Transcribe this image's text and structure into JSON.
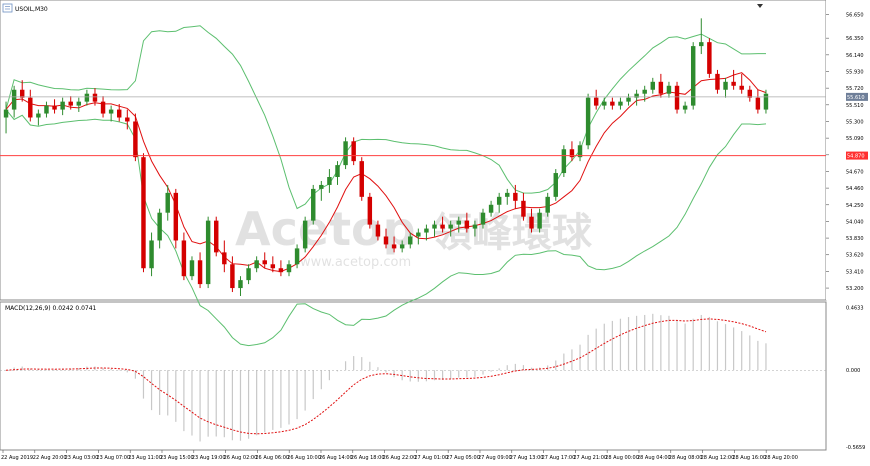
{
  "window": {
    "title": "USOIL,M30",
    "macd_label": "MACD(12,26,9) 0.0242 0.0741"
  },
  "watermark": {
    "brand": "Acetop",
    "cn": "領峰環球",
    "url": "www.acetop.com"
  },
  "colors": {
    "bull": "#2e8b2e",
    "bear": "#d40000",
    "bollinger": "#5cbf6f",
    "ma": "#e01010",
    "hline": "#ff4040",
    "macd_hist": "#c8c8c8",
    "macd_signal": "#e01010"
  },
  "chart_data": [
    {
      "type": "candlestick",
      "symbol": "USOIL",
      "timeframe": "M30",
      "ylim": [
        53.1,
        56.68
      ],
      "y_ticks": [
        "56.650",
        "56.350",
        "56.140",
        "55.930",
        "55.720",
        "55.510",
        "55.300",
        "55.090",
        "54.880",
        "54.670",
        "54.460",
        "54.250",
        "54.040",
        "53.830",
        "53.620",
        "53.410",
        "53.200"
      ],
      "current_price": 55.61,
      "current_price_label": "55.610",
      "level": 54.87,
      "level_label": "54.870",
      "x_labels": [
        "22 Aug 2019",
        "22 Aug 20:00",
        "23 Aug 03:00",
        "23 Aug 07:00",
        "23 Aug 11:00",
        "23 Aug 15:00",
        "23 Aug 19:00",
        "26 Aug 02:00",
        "26 Aug 06:00",
        "26 Aug 10:00",
        "26 Aug 14:00",
        "26 Aug 18:00",
        "26 Aug 22:00",
        "27 Aug 01:00",
        "27 Aug 05:00",
        "27 Aug 09:00",
        "27 Aug 13:00",
        "27 Aug 17:00",
        "27 Aug 21:00",
        "28 Aug 00:00",
        "28 Aug 04:00",
        "28 Aug 08:00",
        "28 Aug 12:00",
        "28 Aug 16:00",
        "28 Aug 20:00"
      ],
      "candles": [
        [
          55.35,
          55.55,
          55.15,
          55.45
        ],
        [
          55.45,
          55.75,
          55.35,
          55.7
        ],
        [
          55.7,
          55.82,
          55.55,
          55.6
        ],
        [
          55.6,
          55.7,
          55.3,
          55.35
        ],
        [
          55.35,
          55.45,
          55.25,
          55.4
        ],
        [
          55.4,
          55.55,
          55.35,
          55.5
        ],
        [
          55.5,
          55.58,
          55.4,
          55.45
        ],
        [
          55.45,
          55.6,
          55.38,
          55.55
        ],
        [
          55.55,
          55.62,
          55.45,
          55.5
        ],
        [
          55.5,
          55.6,
          55.42,
          55.55
        ],
        [
          55.55,
          55.7,
          55.5,
          55.65
        ],
        [
          55.65,
          55.72,
          55.5,
          55.55
        ],
        [
          55.55,
          55.62,
          55.35,
          55.4
        ],
        [
          55.4,
          55.5,
          55.3,
          55.45
        ],
        [
          55.45,
          55.52,
          55.3,
          55.35
        ],
        [
          55.35,
          55.45,
          55.2,
          55.3
        ],
        [
          55.3,
          55.4,
          54.8,
          54.85
        ],
        [
          54.85,
          54.9,
          53.4,
          53.45
        ],
        [
          53.45,
          53.9,
          53.35,
          53.8
        ],
        [
          53.8,
          54.2,
          53.7,
          54.15
        ],
        [
          54.15,
          54.5,
          54.05,
          54.4
        ],
        [
          54.4,
          54.45,
          53.7,
          53.8
        ],
        [
          53.8,
          53.9,
          53.3,
          53.35
        ],
        [
          53.35,
          53.6,
          53.3,
          53.55
        ],
        [
          53.55,
          53.65,
          53.2,
          53.25
        ],
        [
          53.25,
          54.1,
          53.2,
          54.05
        ],
        [
          54.05,
          54.1,
          53.6,
          53.65
        ],
        [
          53.65,
          53.8,
          53.4,
          53.5
        ],
        [
          53.5,
          53.6,
          53.15,
          53.2
        ],
        [
          53.2,
          53.35,
          53.1,
          53.3
        ],
        [
          53.3,
          53.5,
          53.25,
          53.45
        ],
        [
          53.45,
          53.6,
          53.4,
          53.55
        ],
        [
          53.55,
          53.65,
          53.45,
          53.5
        ],
        [
          53.5,
          53.6,
          53.4,
          53.45
        ],
        [
          53.45,
          53.55,
          53.35,
          53.4
        ],
        [
          53.4,
          53.55,
          53.35,
          53.5
        ],
        [
          53.5,
          53.75,
          53.45,
          53.7
        ],
        [
          53.7,
          54.1,
          53.65,
          54.05
        ],
        [
          54.05,
          54.5,
          54.0,
          54.45
        ],
        [
          54.45,
          54.55,
          54.3,
          54.5
        ],
        [
          54.5,
          54.7,
          54.4,
          54.6
        ],
        [
          54.6,
          54.8,
          54.5,
          54.75
        ],
        [
          54.75,
          55.1,
          54.7,
          55.05
        ],
        [
          55.05,
          55.1,
          54.75,
          54.8
        ],
        [
          54.8,
          54.85,
          54.3,
          54.35
        ],
        [
          54.35,
          54.4,
          53.95,
          54.0
        ],
        [
          54.0,
          54.05,
          53.8,
          53.85
        ],
        [
          53.85,
          53.95,
          53.7,
          53.75
        ],
        [
          53.75,
          53.85,
          53.65,
          53.7
        ],
        [
          53.7,
          53.8,
          53.65,
          53.75
        ],
        [
          53.75,
          53.9,
          53.7,
          53.85
        ],
        [
          53.85,
          53.95,
          53.75,
          53.9
        ],
        [
          53.9,
          54.0,
          53.8,
          53.95
        ],
        [
          53.95,
          54.05,
          53.85,
          54.0
        ],
        [
          54.0,
          54.1,
          53.9,
          53.95
        ],
        [
          53.95,
          54.05,
          53.85,
          54.0
        ],
        [
          54.0,
          54.1,
          53.9,
          54.05
        ],
        [
          54.05,
          54.15,
          53.9,
          53.95
        ],
        [
          53.95,
          54.05,
          53.85,
          54.0
        ],
        [
          54.0,
          54.2,
          53.95,
          54.15
        ],
        [
          54.15,
          54.3,
          54.1,
          54.25
        ],
        [
          54.25,
          54.4,
          54.15,
          54.35
        ],
        [
          54.35,
          54.45,
          54.25,
          54.4
        ],
        [
          54.4,
          54.5,
          54.2,
          54.3
        ],
        [
          54.3,
          54.4,
          54.05,
          54.1
        ],
        [
          54.1,
          54.2,
          53.9,
          53.95
        ],
        [
          53.95,
          54.2,
          53.9,
          54.15
        ],
        [
          54.15,
          54.4,
          54.1,
          54.35
        ],
        [
          54.35,
          54.7,
          54.3,
          54.65
        ],
        [
          54.65,
          55.0,
          54.6,
          54.95
        ],
        [
          54.95,
          55.05,
          54.8,
          54.85
        ],
        [
          54.85,
          55.05,
          54.8,
          55.0
        ],
        [
          55.0,
          55.65,
          54.95,
          55.6
        ],
        [
          55.6,
          55.7,
          55.45,
          55.5
        ],
        [
          55.5,
          55.6,
          55.45,
          55.55
        ],
        [
          55.55,
          55.6,
          55.45,
          55.5
        ],
        [
          55.5,
          55.6,
          55.45,
          55.55
        ],
        [
          55.55,
          55.65,
          55.5,
          55.6
        ],
        [
          55.6,
          55.7,
          55.5,
          55.65
        ],
        [
          55.65,
          55.75,
          55.55,
          55.7
        ],
        [
          55.7,
          55.85,
          55.65,
          55.8
        ],
        [
          55.8,
          55.9,
          55.6,
          55.65
        ],
        [
          55.65,
          55.8,
          55.6,
          55.75
        ],
        [
          55.75,
          55.8,
          55.4,
          55.45
        ],
        [
          55.45,
          55.55,
          55.4,
          55.5
        ],
        [
          55.5,
          56.3,
          55.45,
          56.25
        ],
        [
          56.25,
          56.6,
          56.15,
          56.3
        ],
        [
          56.3,
          56.35,
          55.85,
          55.9
        ],
        [
          55.9,
          55.95,
          55.65,
          55.7
        ],
        [
          55.7,
          55.85,
          55.6,
          55.8
        ],
        [
          55.8,
          55.95,
          55.7,
          55.75
        ],
        [
          55.75,
          55.9,
          55.65,
          55.7
        ],
        [
          55.7,
          55.75,
          55.55,
          55.6
        ],
        [
          55.6,
          55.7,
          55.4,
          55.45
        ],
        [
          55.45,
          55.7,
          55.4,
          55.65
        ]
      ]
    },
    {
      "type": "line",
      "title": "MACD(12,26,9) 0.0242 0.0741",
      "ylim": [
        -0.575,
        0.475
      ],
      "y_ticks": [
        "0.4633",
        "0.000",
        "-0.5659"
      ]
    }
  ]
}
